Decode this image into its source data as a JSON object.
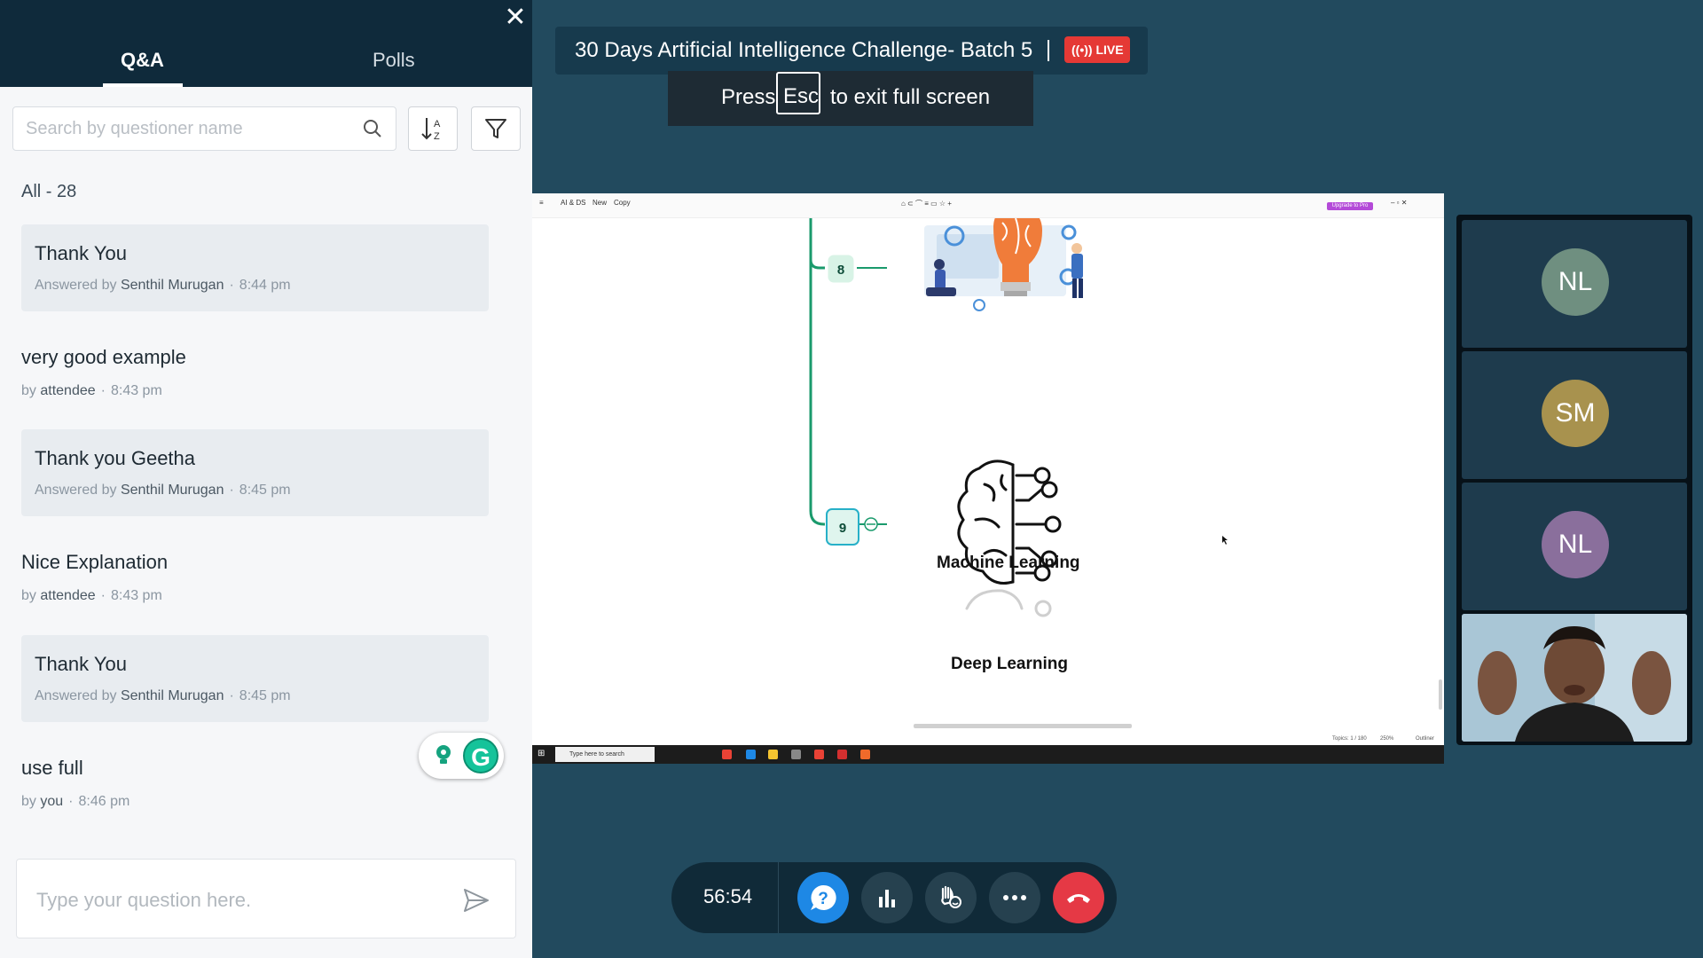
{
  "qa_panel": {
    "tabs": [
      {
        "label": "Q&A",
        "active": true
      },
      {
        "label": "Polls",
        "active": false
      }
    ],
    "search_placeholder": "Search by questioner name",
    "count_label": "All - 28",
    "questions": [
      {
        "text": "Thank You",
        "prefix": "Answered by",
        "name": "Senthil Murugan",
        "time": "8:44 pm",
        "answered": true
      },
      {
        "text": "very good example",
        "prefix": "by",
        "name": "attendee",
        "time": "8:43 pm",
        "answered": false
      },
      {
        "text": "Thank you Geetha",
        "prefix": "Answered by",
        "name": "Senthil Murugan",
        "time": "8:45 pm",
        "answered": true
      },
      {
        "text": "Nice Explanation",
        "prefix": "by",
        "name": "attendee",
        "time": "8:43 pm",
        "answered": false
      },
      {
        "text": "Thank You",
        "prefix": "Answered by",
        "name": "Senthil Murugan",
        "time": "8:45 pm",
        "answered": true
      },
      {
        "text": "use full",
        "prefix": "by",
        "name": "you",
        "time": "8:46 pm",
        "answered": false
      }
    ],
    "input_placeholder": "Type your question here.",
    "separator": "·"
  },
  "session": {
    "title": "30 Days Artificial Intelligence Challenge- Batch 5",
    "live_label": "LIVE",
    "live_color": "#e53935"
  },
  "fullscreen_hint": {
    "press": "Press",
    "key": "Esc",
    "rest": "to exit full screen"
  },
  "shared_screen": {
    "app_menu": [
      "AI & DS",
      "New",
      "Copy"
    ],
    "upgrade_label": "Upgrade to Pro",
    "nodes": [
      {
        "number": "8",
        "label": "Machine Learning"
      },
      {
        "number": "9",
        "label": "Deep Learning"
      }
    ],
    "status_topics": "Topics: 1 / 180",
    "status_zoom": "250%",
    "status_mode": "Outliner",
    "taskbar_search": "Type here to search"
  },
  "participants": [
    {
      "initials": "NL",
      "color": "#6f8f80"
    },
    {
      "initials": "SM",
      "color": "#a8924e"
    },
    {
      "initials": "NL",
      "color": "#8a6f9c"
    }
  ],
  "controls": {
    "timer": "56:54",
    "qa_color": "#1e88e5",
    "end_color": "#e53945"
  }
}
